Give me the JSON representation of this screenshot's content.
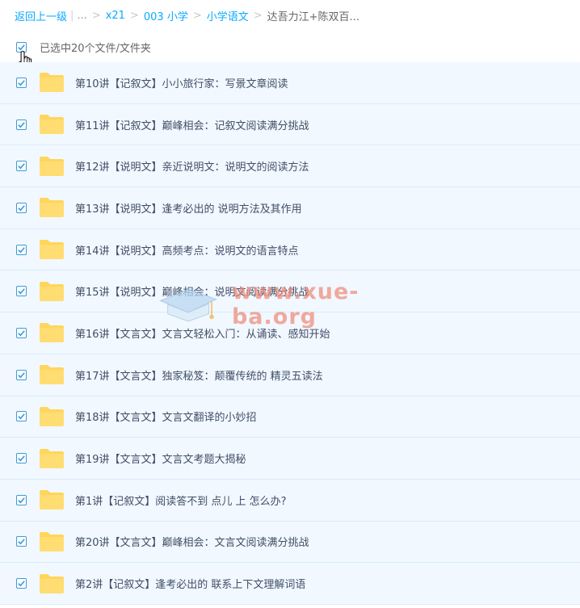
{
  "breadcrumb": {
    "back": "返回上一级",
    "ellipsis": "...",
    "path": [
      "x21",
      "003 小学",
      "小学语文"
    ],
    "current": "达吾力江+陈双百..."
  },
  "selection": {
    "label": "已选中20个文件/文件夹"
  },
  "files": [
    {
      "name": "第10讲【记叙文】小小旅行家：写景文章阅读"
    },
    {
      "name": "第11讲【记叙文】巅峰相会：记叙文阅读满分挑战"
    },
    {
      "name": "第12讲【说明文】亲近说明文：说明文的阅读方法"
    },
    {
      "name": "第13讲【说明文】逢考必出的 说明方法及其作用"
    },
    {
      "name": "第14讲【说明文】高频考点：说明文的语言特点"
    },
    {
      "name": "第15讲【说明文】巅峰相会：说明文阅读满分挑战"
    },
    {
      "name": "第16讲【文言文】文言文轻松入门：从诵读、感知开始"
    },
    {
      "name": "第17讲【文言文】独家秘笈：颠覆传统的 精灵五读法"
    },
    {
      "name": "第18讲【文言文】文言文翻译的小妙招"
    },
    {
      "name": "第19讲【文言文】文言文考题大揭秘"
    },
    {
      "name": "第1讲【记叙文】阅读答不到 点儿 上 怎么办?"
    },
    {
      "name": "第20讲【文言文】巅峰相会：文言文阅读满分挑战"
    },
    {
      "name": "第2讲【记叙文】逢考必出的 联系上下文理解词语"
    }
  ],
  "watermark": {
    "text": "www.xue-ba.org"
  },
  "icons": {
    "checkbox": "checkbox-checked-icon",
    "folder": "folder-icon",
    "cursor": "hand-cursor-icon"
  },
  "colors": {
    "link": "#09aaff",
    "row_bg": "#f1f8ff",
    "check": "#3d9bd8",
    "folder": "#ffd65c"
  }
}
